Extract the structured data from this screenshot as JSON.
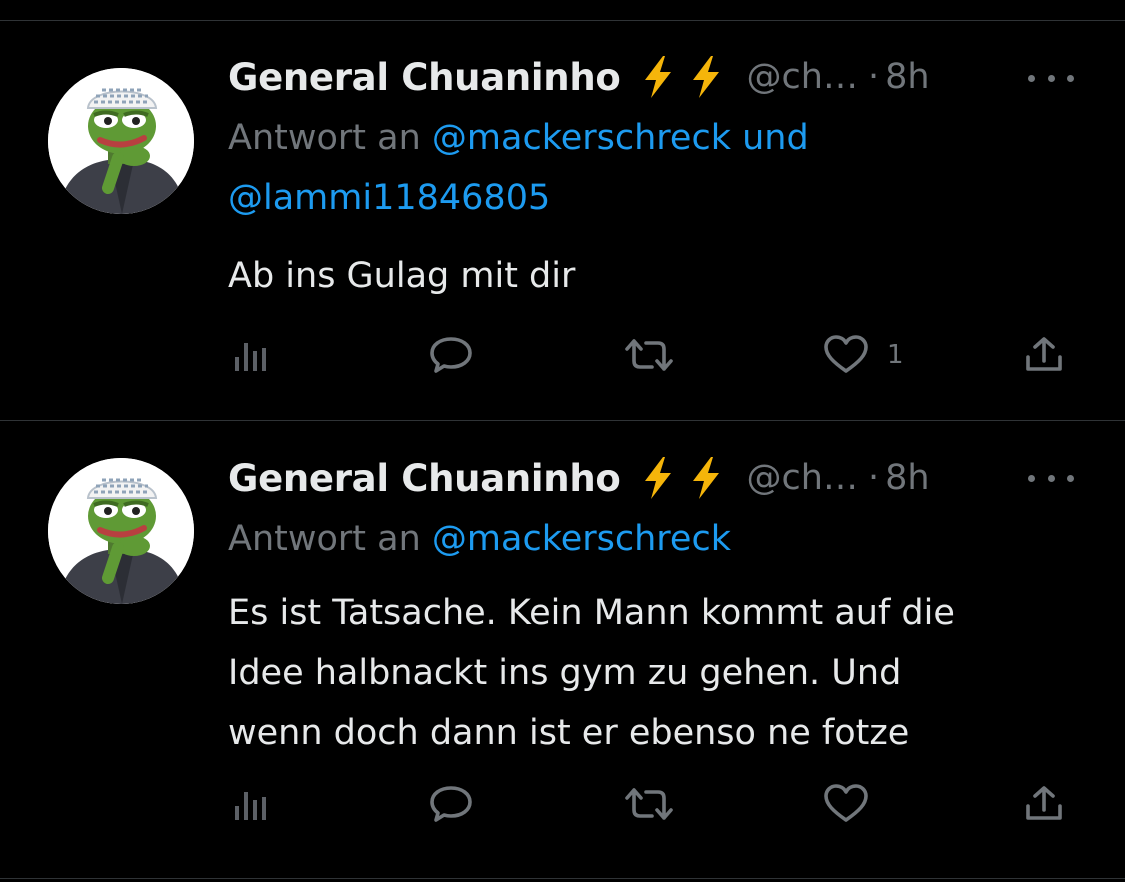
{
  "colors": {
    "background": "#000000",
    "text": "#e7e9ea",
    "secondary": "#71767b",
    "accent": "#1d9bf0",
    "divider": "#2f3336",
    "bolt": "#f5b50a"
  },
  "tweets": [
    {
      "author": {
        "display_name": "General Chuaninho",
        "badges": [
          "lightning-icon",
          "lightning-icon"
        ],
        "handle": "@ch…",
        "separator": "·",
        "time": "8h"
      },
      "reply_prefix": "Antwort an",
      "reply_mention_1": "@mackerschreck",
      "reply_conjunction": "und",
      "reply_mention_2": "@lammi11846805",
      "text": "Ab ins Gulag mit dir",
      "actions": {
        "like_count": "1"
      }
    },
    {
      "author": {
        "display_name": "General Chuaninho",
        "badges": [
          "lightning-icon",
          "lightning-icon"
        ],
        "handle": "@ch…",
        "separator": "·",
        "time": "8h"
      },
      "reply_prefix": "Antwort an",
      "reply_mention_1": "@mackerschreck",
      "text_line_1": "Es ist Tatsache. Kein Mann kommt auf die",
      "text_line_2": "Idee halbnackt ins gym zu gehen. Und",
      "text_line_3": "wenn doch dann ist er ebenso ne fotze",
      "actions": {
        "like_count": ""
      }
    }
  ]
}
